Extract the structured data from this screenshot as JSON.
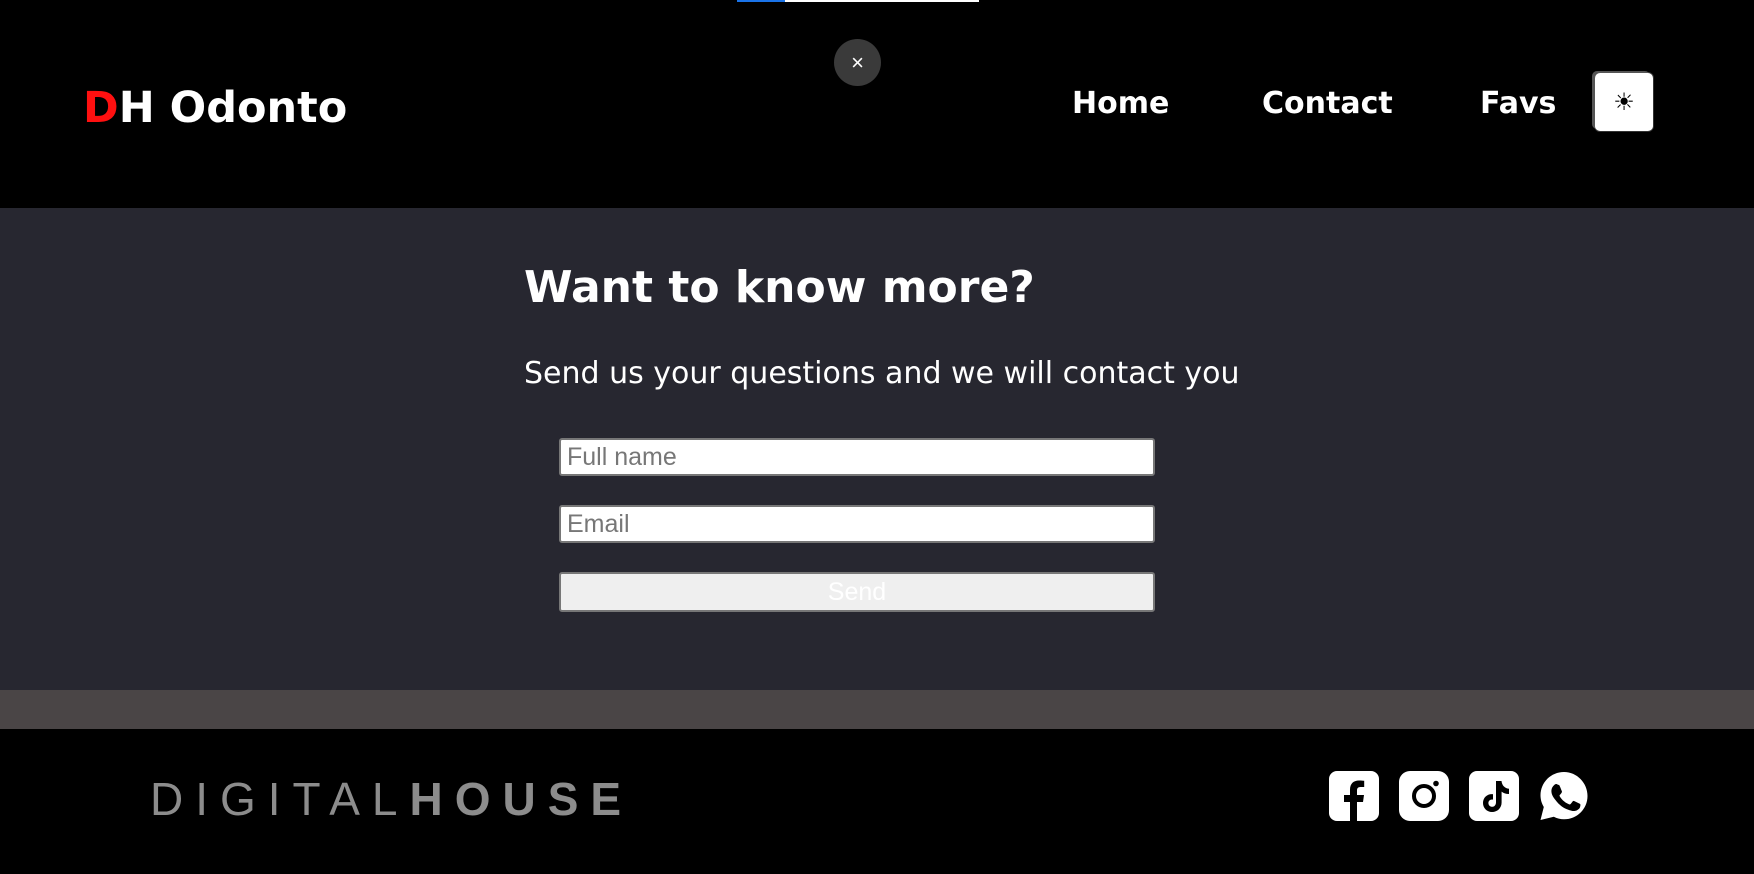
{
  "top_progress": {
    "value_fraction": 0.2
  },
  "header": {
    "logo_accent": "D",
    "logo_rest": "H Odonto",
    "close_symbol": "×",
    "nav": {
      "home": "Home",
      "contact": "Contact",
      "favs": "Favs"
    },
    "theme_toggle_icon": "sun-icon",
    "theme_toggle_symbol": "☀"
  },
  "contact": {
    "title": "Want to know more?",
    "subtitle": "Send us your questions and we will contact you",
    "name_placeholder": "Full name",
    "email_placeholder": "Email",
    "send_label": "Send"
  },
  "footer": {
    "brand_light": "DIGITAL",
    "brand_heavy": "HOUSE",
    "social_icons": [
      "facebook-icon",
      "instagram-icon",
      "tiktok-icon",
      "whatsapp-icon"
    ]
  },
  "colors": {
    "logo_accent": "#ff1010",
    "header_bg": "#000000",
    "section_bg": "#272730",
    "band_bg": "#4a4546",
    "brand_gray": "#8c8c8c"
  }
}
